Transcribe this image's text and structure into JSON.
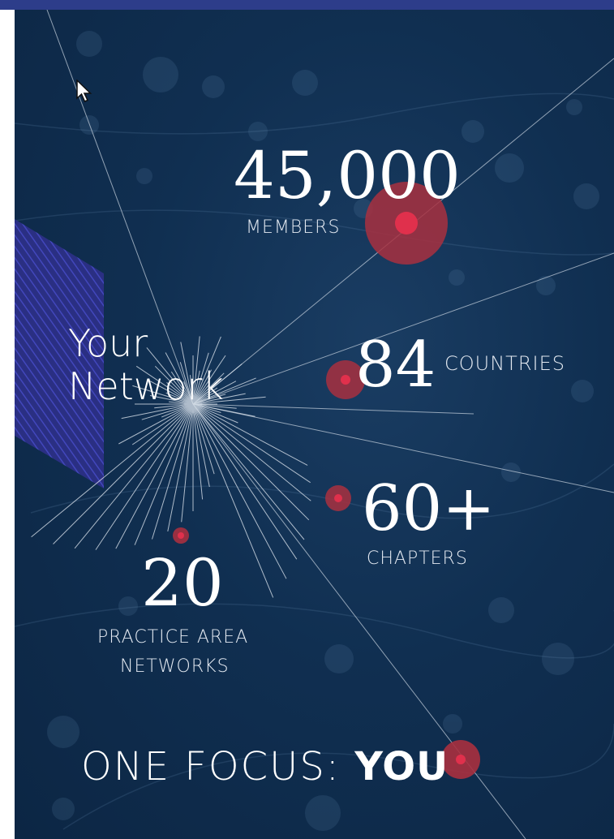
{
  "headline": {
    "line1": "Your",
    "line2": "Network"
  },
  "stats": {
    "members": {
      "value": "45,000",
      "label": "MEMBERS"
    },
    "countries": {
      "value": "84",
      "label": "COUNTRIES"
    },
    "chapters": {
      "value": "60+",
      "label": "CHAPTERS"
    },
    "practice": {
      "value": "20",
      "label_line1": "PRACTICE AREA",
      "label_line2": "NETWORKS"
    }
  },
  "footer": {
    "prefix": "ONE FOCUS:",
    "emphasis": "YOU"
  },
  "colors": {
    "background": "#102f51",
    "accent_red": "#d92d47",
    "accent_red_halo": "#a8303f",
    "hexagon": "#34379e",
    "top_bar": "#2d3d8a"
  },
  "icons": [
    "mouse-cursor-icon",
    "hexagon-pattern-icon",
    "network-dot-icon"
  ]
}
